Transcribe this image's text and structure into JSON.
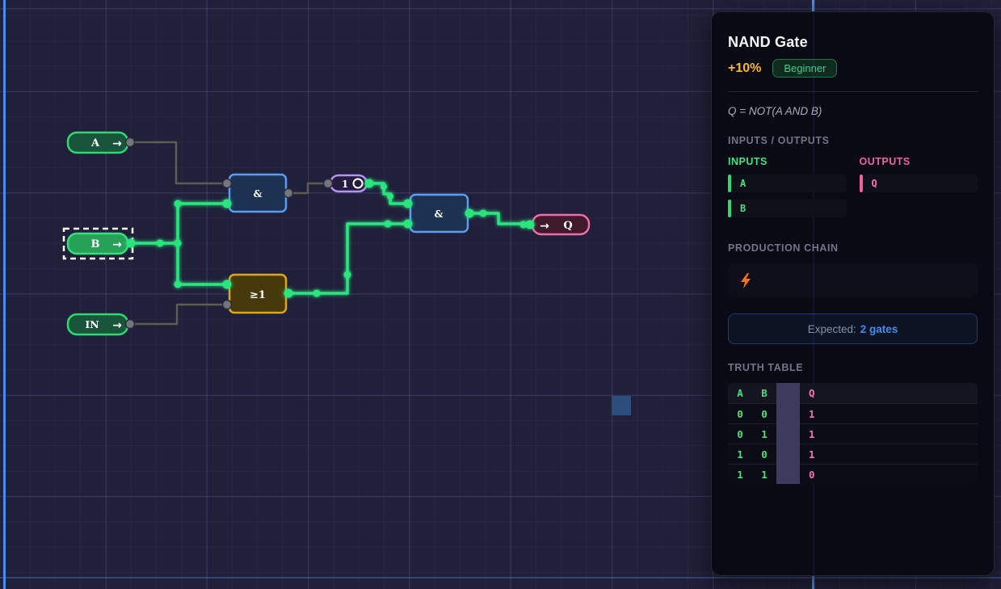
{
  "canvas": {
    "arrow_glyph": "→",
    "nodes": {
      "input_a": {
        "label": "A"
      },
      "input_b": {
        "label": "B"
      },
      "input_in": {
        "label": "IN"
      },
      "gate_and_1": {
        "label": "&"
      },
      "gate_not_1": {
        "label": "1"
      },
      "gate_and_2": {
        "label": "&"
      },
      "gate_or_1": {
        "label": "≥1"
      },
      "output_q": {
        "label": "Q"
      }
    }
  },
  "panel": {
    "title": "NAND Gate",
    "reward": "+10%",
    "difficulty_badge": "Beginner",
    "formula": "Q = NOT(A AND B)",
    "io": {
      "section_header": "INPUTS / OUTPUTS",
      "inputs_label": "INPUTS",
      "outputs_label": "OUTPUTS",
      "inputs": [
        "A",
        "B"
      ],
      "outputs": [
        "Q"
      ]
    },
    "production_chain": {
      "section_header": "PRODUCTION CHAIN"
    },
    "expected": {
      "label": "Expected:",
      "value": "2 gates"
    },
    "truth_table": {
      "section_header": "TRUTH TABLE",
      "input_headers": [
        "A",
        "B"
      ],
      "output_headers": [
        "Q"
      ],
      "rows": [
        {
          "inputs": [
            "0",
            "0"
          ],
          "outputs": [
            "1"
          ]
        },
        {
          "inputs": [
            "0",
            "1"
          ],
          "outputs": [
            "1"
          ]
        },
        {
          "inputs": [
            "1",
            "0"
          ],
          "outputs": [
            "1"
          ]
        },
        {
          "inputs": [
            "1",
            "1"
          ],
          "outputs": [
            "0"
          ]
        }
      ]
    }
  },
  "colors": {
    "input_green": "#2fd873",
    "output_pink": "#f06ca6",
    "and_blue": "#5b9bf2",
    "or_gold": "#dfa616",
    "not_purple": "#b592ec",
    "wire_active_green": "#2be47e",
    "wire_inactive_gray": "#5e5c52",
    "expected_blue": "#3f8cf3",
    "reward_gold": "#f8b928",
    "bolt_orange": "#f97316",
    "axis_blue": "#4a8df0"
  }
}
